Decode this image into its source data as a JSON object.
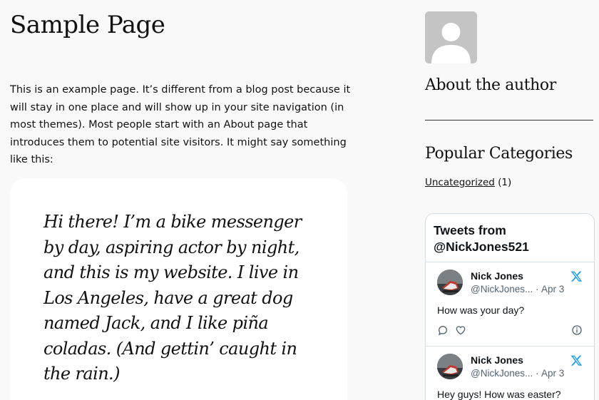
{
  "page": {
    "title": "Sample Page",
    "intro": "This is an example page. It’s different from a blog post because it will stay in one place and will show up in your site navigation (in most themes). Most people start with an About page that introduces them to potential site visitors. It might say something like this:",
    "quote": "Hi there! I’m a bike messenger by day, aspiring actor by night, and this is my website. I live in Los Angeles, have a great dog named Jack, and I like piña coladas. (And gettin’ caught in the rain.)"
  },
  "sidebar": {
    "author_heading": "About the author",
    "categories_heading": "Popular Categories",
    "categories": [
      {
        "name": "Uncategorized",
        "count": "(1)"
      }
    ]
  },
  "twitter": {
    "header": "Tweets from @NickJones521",
    "tweets": [
      {
        "name": "Nick Jones",
        "handle": "@NickJones...",
        "dot": "·",
        "date": "Apr 3",
        "text": "How was your day?"
      },
      {
        "name": "Nick Jones",
        "handle": "@NickJones...",
        "dot": "·",
        "date": "Apr 3",
        "text": "Hey guys! How was easter?"
      }
    ]
  },
  "colors": {
    "background": "#f9f9f9",
    "card": "#ffffff",
    "x_blue": "#1d9bf0",
    "muted_text": "#536471"
  },
  "icons": [
    "default-avatar-icon",
    "x-logo-icon",
    "reply-icon",
    "like-icon",
    "info-icon"
  ]
}
